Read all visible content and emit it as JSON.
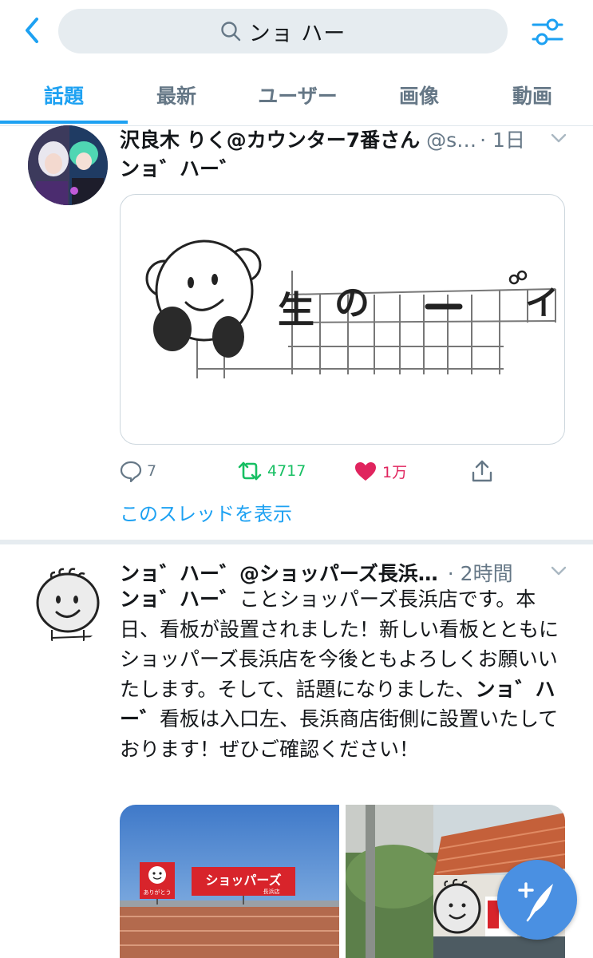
{
  "search": {
    "query": "ンョ ハー"
  },
  "tabs": [
    "話題",
    "最新",
    "ユーザー",
    "画像",
    "動画"
  ],
  "tweet1": {
    "name": "沢良木 りく@カウンター7番さん",
    "handle": "@s…",
    "time": "· 1日",
    "text": "ンョ゛ハー゛",
    "image_text": "生の　一　゛イ",
    "replies": "7",
    "retweets": "4717",
    "likes": "1万",
    "show_thread": "このスレッドを表示"
  },
  "tweet2": {
    "name": "ンョ゛ハー゛@ショッパーズ長浜…",
    "time": "· 2時間",
    "text_bold1": "ンョ゛ハー゛",
    "text_part1": "ことショッパーズ長浜店です。本日、看板が設置されました！新しい看板とともにショッパーズ長浜店を今後ともよろしくお願いいたします。そして、話題になりました、",
    "text_bold2": "ンョ゛ハー゛",
    "text_part2": "看板は入口左、長浜商店街側に設置いたしております！ぜひご確認ください！",
    "sign_main": "ショッパーズ",
    "sign_sub": "長浜店",
    "sign_small": "ありがとう"
  },
  "colors": {
    "accent": "#1da1f2",
    "retweet": "#17bf63",
    "like": "#e0245e",
    "secondary": "#657786"
  },
  "icons": [
    "back-icon",
    "search-icon",
    "filter-icon",
    "reply-icon",
    "retweet-icon",
    "like-icon",
    "share-icon",
    "caret-down-icon",
    "compose-icon"
  ]
}
